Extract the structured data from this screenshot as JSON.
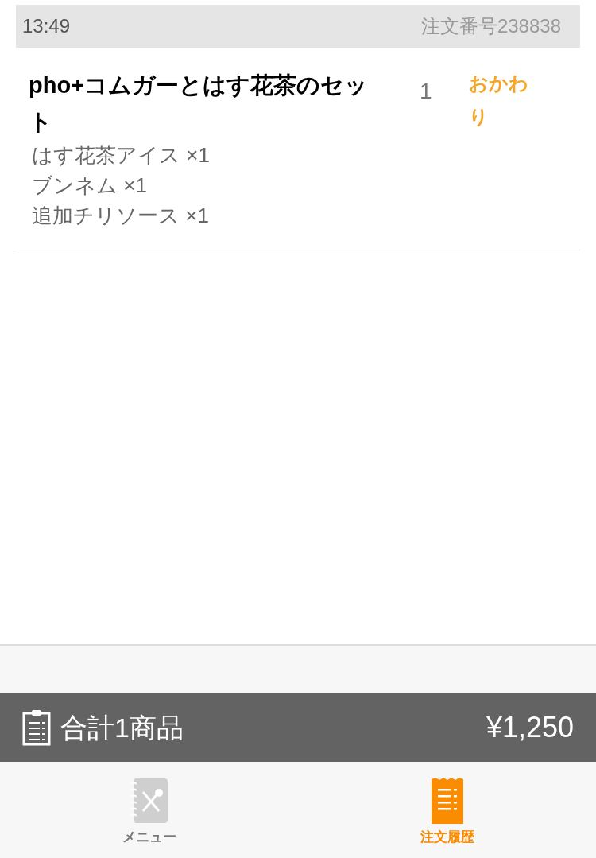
{
  "header": {
    "time": "13:49",
    "order_number": "注文番号238838"
  },
  "order_items": [
    {
      "name": "pho+コムガーとはす花茶のセット",
      "quantity": "1",
      "action": "おかわり",
      "options": [
        "はす花茶アイス ×1",
        "ブンネム ×1",
        "追加チリソース ×1"
      ]
    }
  ],
  "summary": {
    "label": "合計1商品",
    "total": "¥1,250"
  },
  "tabs": [
    {
      "label": "メニュー",
      "kind": "menu",
      "selected": false
    },
    {
      "label": "注文履歴",
      "kind": "history",
      "selected": true
    }
  ]
}
